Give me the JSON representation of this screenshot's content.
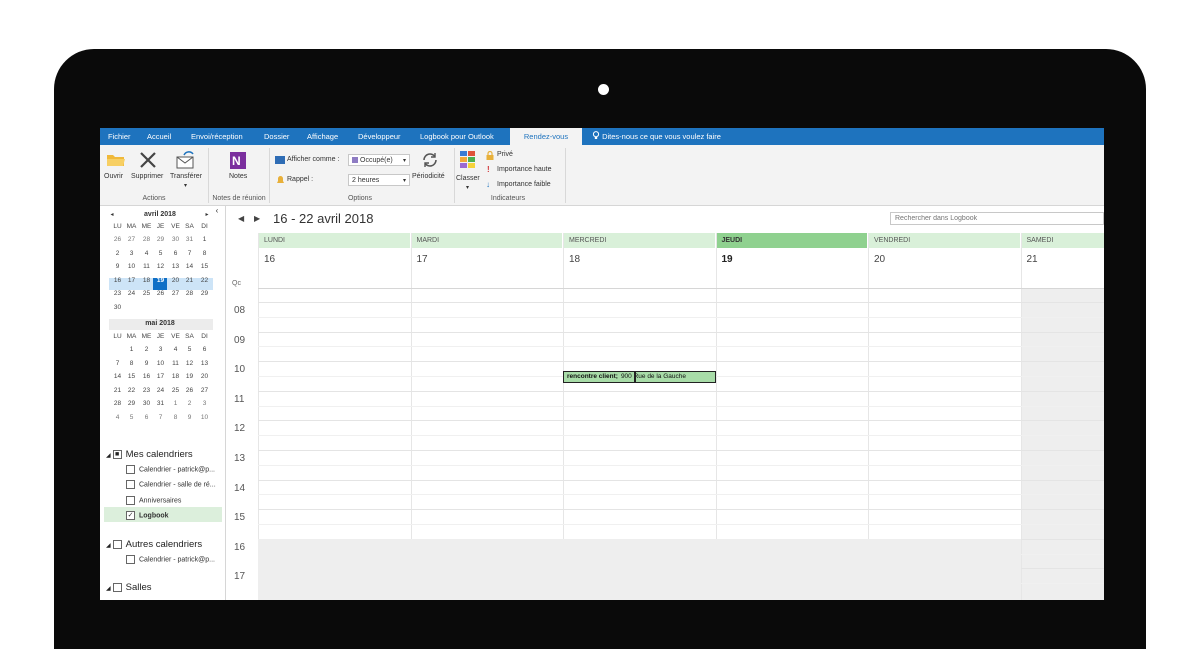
{
  "tabs": [
    "Fichier",
    "Accueil",
    "Envoi/réception",
    "Dossier",
    "Affichage",
    "Développeur",
    "Logbook pour Outlook",
    "Rendez-vous"
  ],
  "tell_me": "Dites-nous ce que vous voulez faire",
  "ribbon": {
    "open": "Ouvrir",
    "delete": "Supprimer",
    "forward": "Transférer",
    "notes": "Notes",
    "show_as": "Afficher comme :",
    "show_as_value": "Occupé(e)",
    "reminder": "Rappel :",
    "reminder_value": "2 heures",
    "recurrence": "Périodicité",
    "categorize": "Classer",
    "private": "Privé",
    "high_importance": "Importance haute",
    "low_importance": "Importance faible",
    "groups": {
      "actions": "Actions",
      "meeting_notes": "Notes de réunion",
      "options": "Options",
      "tags": "Indicateurs"
    }
  },
  "mini_cal": {
    "dow": [
      "LU",
      "MA",
      "ME",
      "JE",
      "VE",
      "SA",
      "DI"
    ],
    "april": {
      "title": "avril 2018",
      "weeks": [
        [
          "26",
          "27",
          "28",
          "29",
          "30",
          "31",
          "1"
        ],
        [
          "2",
          "3",
          "4",
          "5",
          "6",
          "7",
          "8"
        ],
        [
          "9",
          "10",
          "11",
          "12",
          "13",
          "14",
          "15"
        ],
        [
          "16",
          "17",
          "18",
          "19",
          "20",
          "21",
          "22"
        ],
        [
          "23",
          "24",
          "25",
          "26",
          "27",
          "28",
          "29"
        ],
        [
          "30"
        ]
      ]
    },
    "may": {
      "title": "mai 2018",
      "weeks": [
        [
          "",
          "1",
          "2",
          "3",
          "4",
          "5",
          "6"
        ],
        [
          "7",
          "8",
          "9",
          "10",
          "11",
          "12",
          "13"
        ],
        [
          "14",
          "15",
          "16",
          "17",
          "18",
          "19",
          "20"
        ],
        [
          "21",
          "22",
          "23",
          "24",
          "25",
          "26",
          "27"
        ],
        [
          "28",
          "29",
          "30",
          "31",
          "1",
          "2",
          "3"
        ],
        [
          "4",
          "5",
          "6",
          "7",
          "8",
          "9",
          "10"
        ]
      ]
    }
  },
  "calendars": {
    "my_group": "Mes calendriers",
    "my_items": [
      "Calendrier - patrick@p...",
      "Calendrier - salle de ré...",
      "Anniversaires",
      "Logbook"
    ],
    "other_group": "Autres calendriers",
    "other_items": [
      "Calendrier - patrick@p..."
    ],
    "rooms_group": "Salles"
  },
  "calendar": {
    "range": "16 - 22 avril 2018",
    "search_placeholder": "Rechercher dans Logbook",
    "days": [
      {
        "name": "LUNDI",
        "num": "16"
      },
      {
        "name": "MARDI",
        "num": "17"
      },
      {
        "name": "MERCREDI",
        "num": "18"
      },
      {
        "name": "JEUDI",
        "num": "19"
      },
      {
        "name": "VENDREDI",
        "num": "20"
      },
      {
        "name": "SAMEDI",
        "num": "21"
      }
    ],
    "tz_label": "Qc",
    "hours": [
      "08",
      "09",
      "10",
      "11",
      "12",
      "13",
      "14",
      "15",
      "16",
      "17"
    ],
    "event": {
      "title": "rencontre client;",
      "location": "900 Rue de la Gauche",
      "day": "MERCREDI",
      "start": "10:15"
    }
  },
  "colors": {
    "accent": "#1e73be",
    "day_header": "#d9f0d9",
    "today_header": "#8fd18f",
    "event": "#a8dca8"
  }
}
